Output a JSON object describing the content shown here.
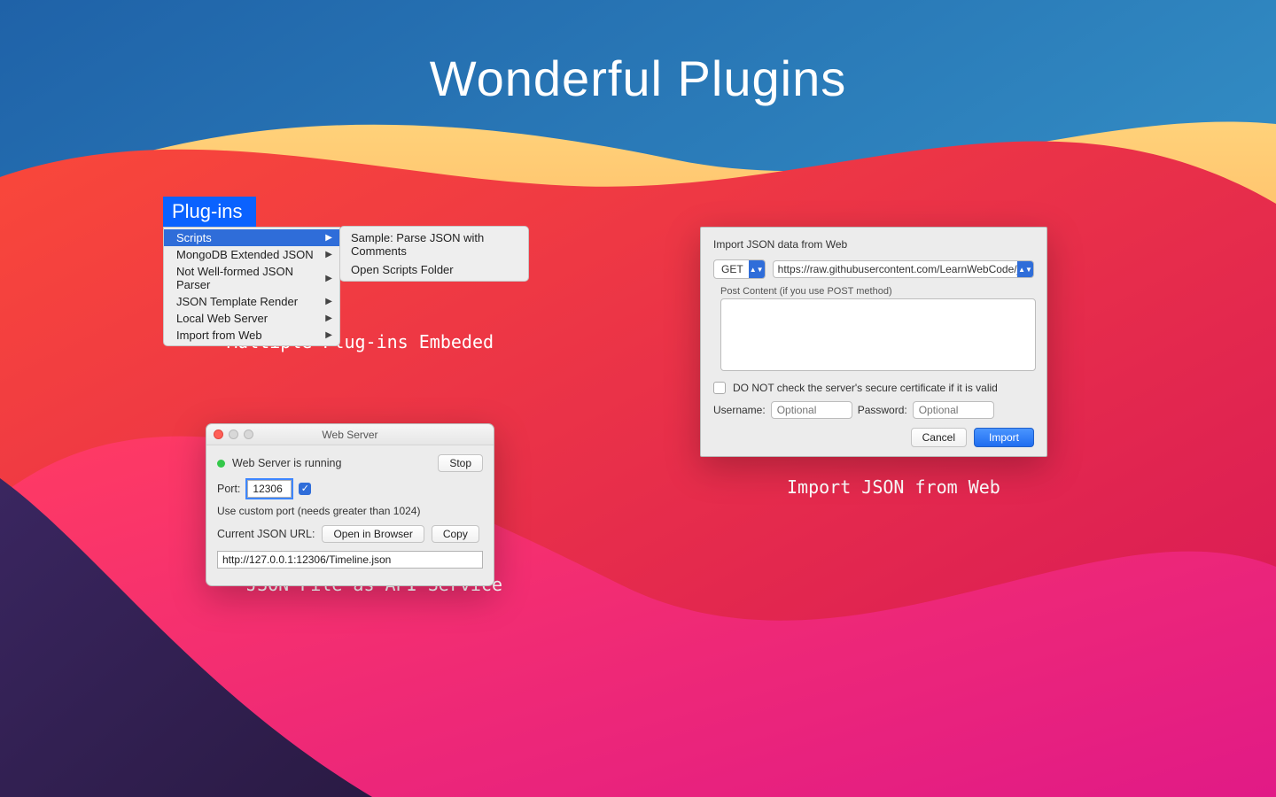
{
  "page_title": "Wonderful Plugins",
  "captions": {
    "plugins": "Multiple Plug-ins Embeded",
    "webserver": "JSON File as API Service",
    "import": "Import JSON from Web"
  },
  "menu": {
    "header": "Plug-ins",
    "items": [
      "Scripts",
      "MongoDB Extended JSON",
      "Not Well-formed JSON Parser",
      "JSON Template Render",
      "Local Web Server",
      "Import from Web"
    ],
    "submenu": [
      "Sample: Parse JSON with Comments",
      "Open Scripts Folder"
    ]
  },
  "webserver": {
    "title": "Web Server",
    "status": "Web Server is running",
    "stop": "Stop",
    "port_label": "Port:",
    "port_value": "12306",
    "custom_port": "Use custom port (needs greater than 1024)",
    "url_label": "Current JSON URL:",
    "open_browser": "Open in Browser",
    "copy": "Copy",
    "url_value": "http://127.0.0.1:12306/Timeline.json"
  },
  "import": {
    "heading": "Import JSON data from Web",
    "method": "GET",
    "url": "https://raw.githubusercontent.com/LearnWebCode/json-example",
    "post_label": "Post Content (if you use POST method)",
    "ssl_label": "DO NOT check the server's secure certificate if it is valid",
    "username_label": "Username:",
    "password_label": "Password:",
    "placeholder": "Optional",
    "cancel": "Cancel",
    "import_btn": "Import"
  }
}
